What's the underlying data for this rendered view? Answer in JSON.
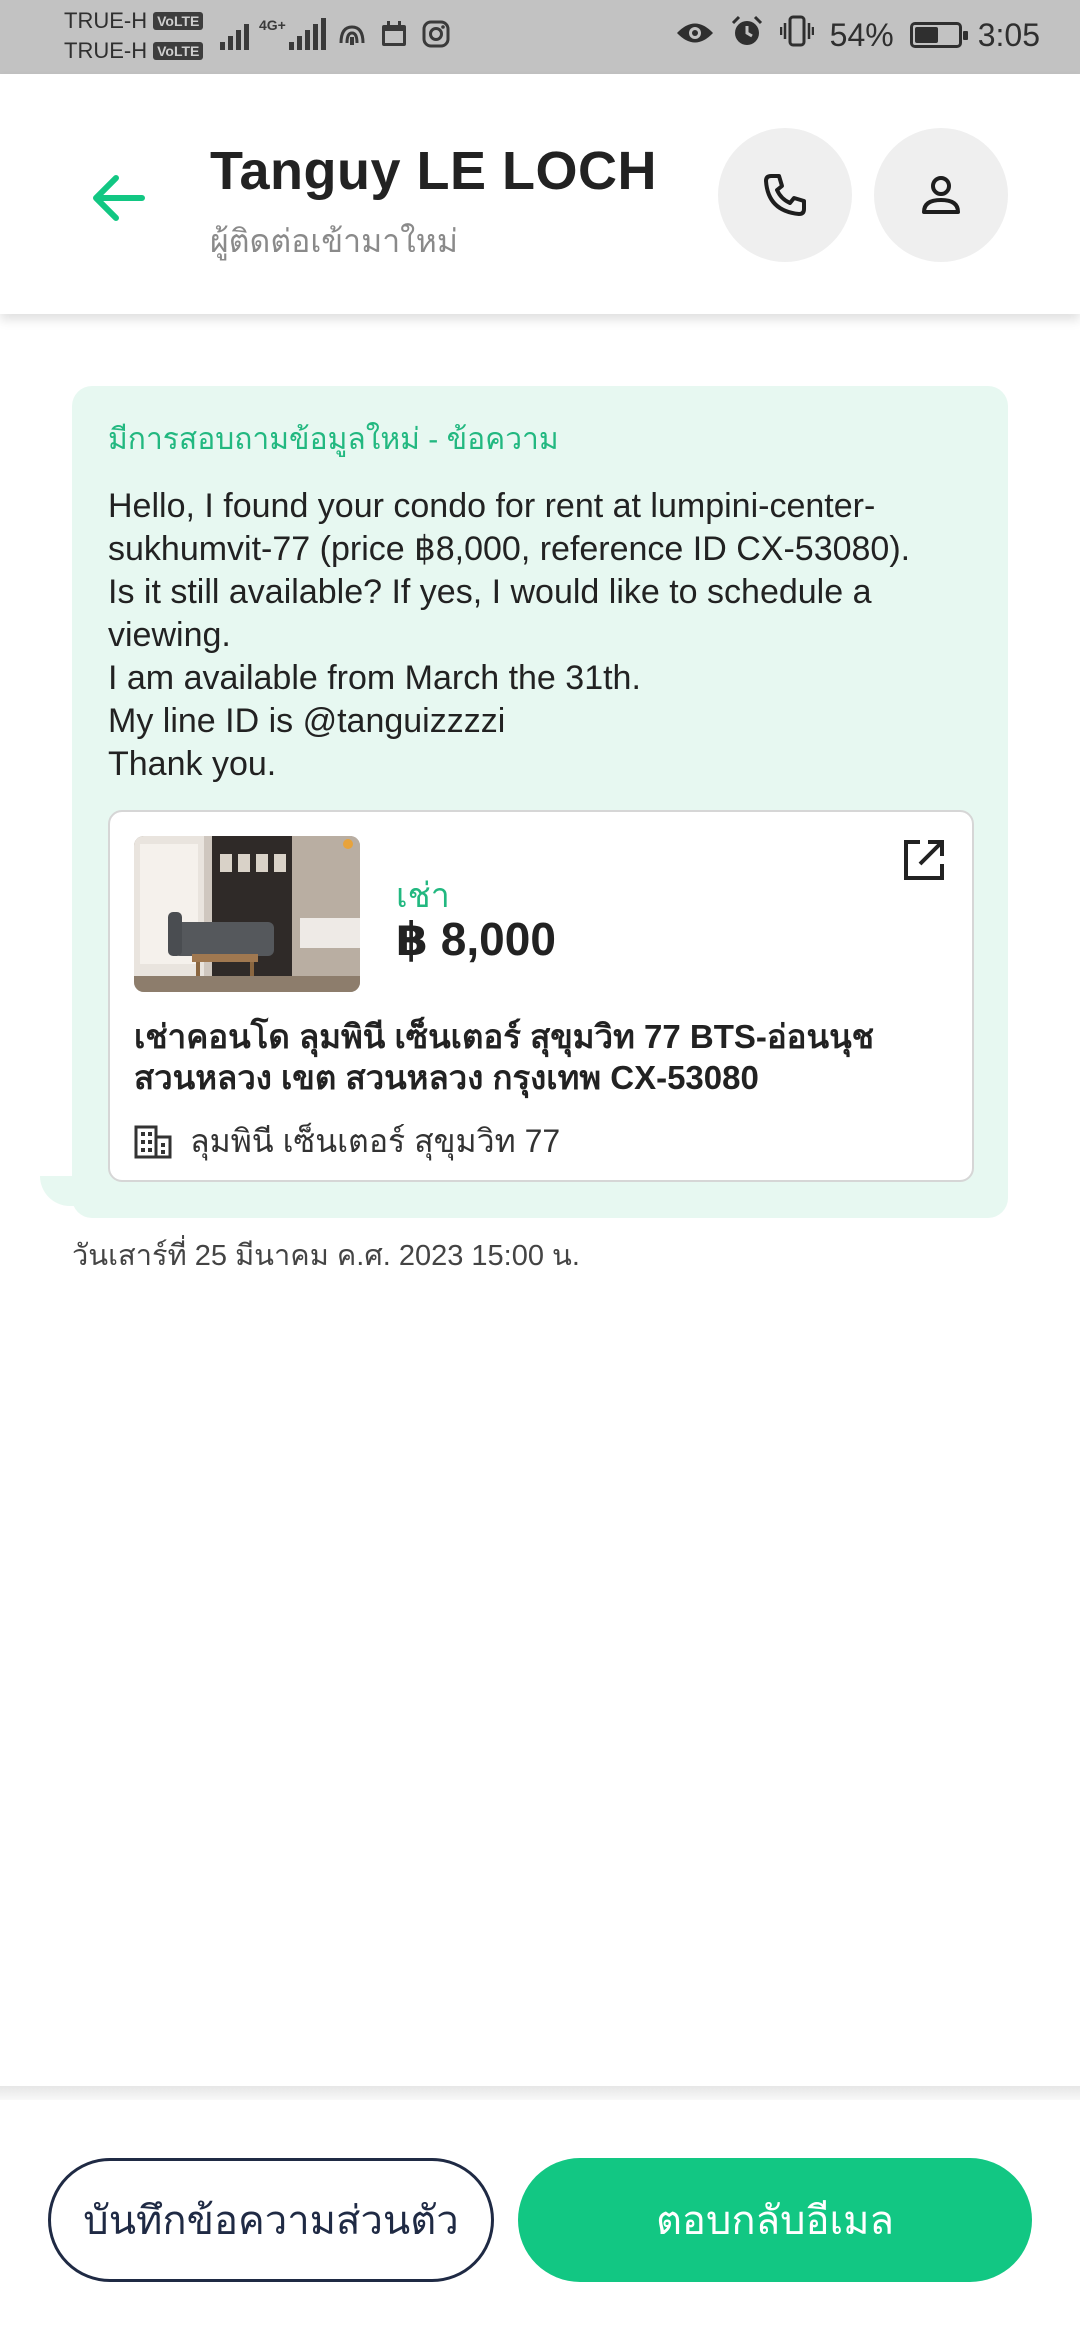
{
  "status_bar": {
    "carrier_1": "TRUE-H",
    "carrier_2": "TRUE-H",
    "volte_badge": "VoLTE",
    "network_label": "4G+",
    "battery_percent": "54%",
    "battery_level": 0.54,
    "time": "3:05",
    "icons": [
      "signal-icon",
      "signal-4g-icon",
      "hotspot-icon",
      "calendar-icon",
      "instagram-icon",
      "eye-icon",
      "alarm-icon",
      "vibrate-icon",
      "battery-icon"
    ]
  },
  "header": {
    "contact_name": "Tanguy LE LOCH",
    "contact_status": "ผู้ติดต่อเข้ามาใหม่",
    "icons": {
      "back": "back-arrow-icon",
      "call": "phone-icon",
      "profile": "person-icon"
    },
    "accent_color": "#12c783"
  },
  "message": {
    "title": "มีการสอบถามข้อมูลใหม่ - ข้อความ",
    "body": "Hello, I found your condo for rent at lumpini-center-sukhumvit-77 (price ฿8,000, reference ID CX-53080).\nIs it still available? If yes, I would like to schedule a viewing.\nI am available from March the 31th.\nMy line ID is @tanguizzzzi\nThank you.",
    "bubble_color": "#e7f8f1",
    "timestamp": "วันเสาร์ที่ 25 มีนาคม ค.ศ. 2023 15:00 น."
  },
  "listing_card": {
    "type": "เช่า",
    "price": "฿ 8,000",
    "title": "เช่าคอนโด  ลุมพินี เซ็นเตอร์ สุขุมวิท 77 BTS-อ่อนนุช สวนหลวง เขต สวนหลวง กรุงเทพ CX-53080",
    "project": "ลุมพินี เซ็นเตอร์ สุขุมวิท 77",
    "icons": {
      "open": "open-external-icon",
      "building": "building-icon",
      "photo": "listing-photo"
    }
  },
  "actions": {
    "note_label": "บันทึกข้อความส่วนตัว",
    "reply_label": "ตอบกลับอีเมล",
    "reply_color": "#12c783"
  }
}
